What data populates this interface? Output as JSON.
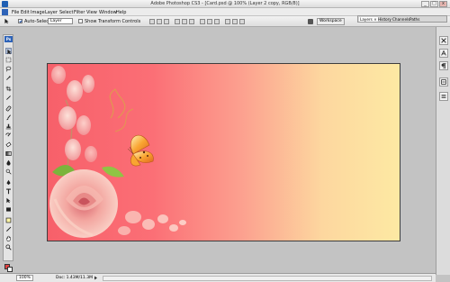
{
  "titlebar": {
    "title": "Adobe Photoshop CS3 - [Card.psd @ 100% (Layer 2 copy, RGB/8)]",
    "minimize": "_",
    "maximize": "□",
    "close": "x"
  },
  "menu": [
    "File",
    "Edit",
    "Image",
    "Layer",
    "Select",
    "Filter",
    "View",
    "Window",
    "Help"
  ],
  "options": {
    "auto_select_label": "Auto-Select:",
    "auto_select_value": "Layer",
    "auto_select_checked": true,
    "show_transform_label": "Show Transform Controls",
    "show_transform_checked": false,
    "workspace_label": "Workspace"
  },
  "panel_tabs": [
    "Layers ×",
    "History",
    "Channels",
    "Paths"
  ],
  "statusbar": {
    "zoom": "100%",
    "doc": "Doc: 1.43M/11.3M"
  },
  "colors": {
    "foreground": "#e64242",
    "background": "#ffffff",
    "gradient_left": "#f7606a",
    "gradient_right": "#fde9a3"
  },
  "canvas": {
    "art": "pink roses and orange butterfly on red-to-yellow gradient"
  }
}
